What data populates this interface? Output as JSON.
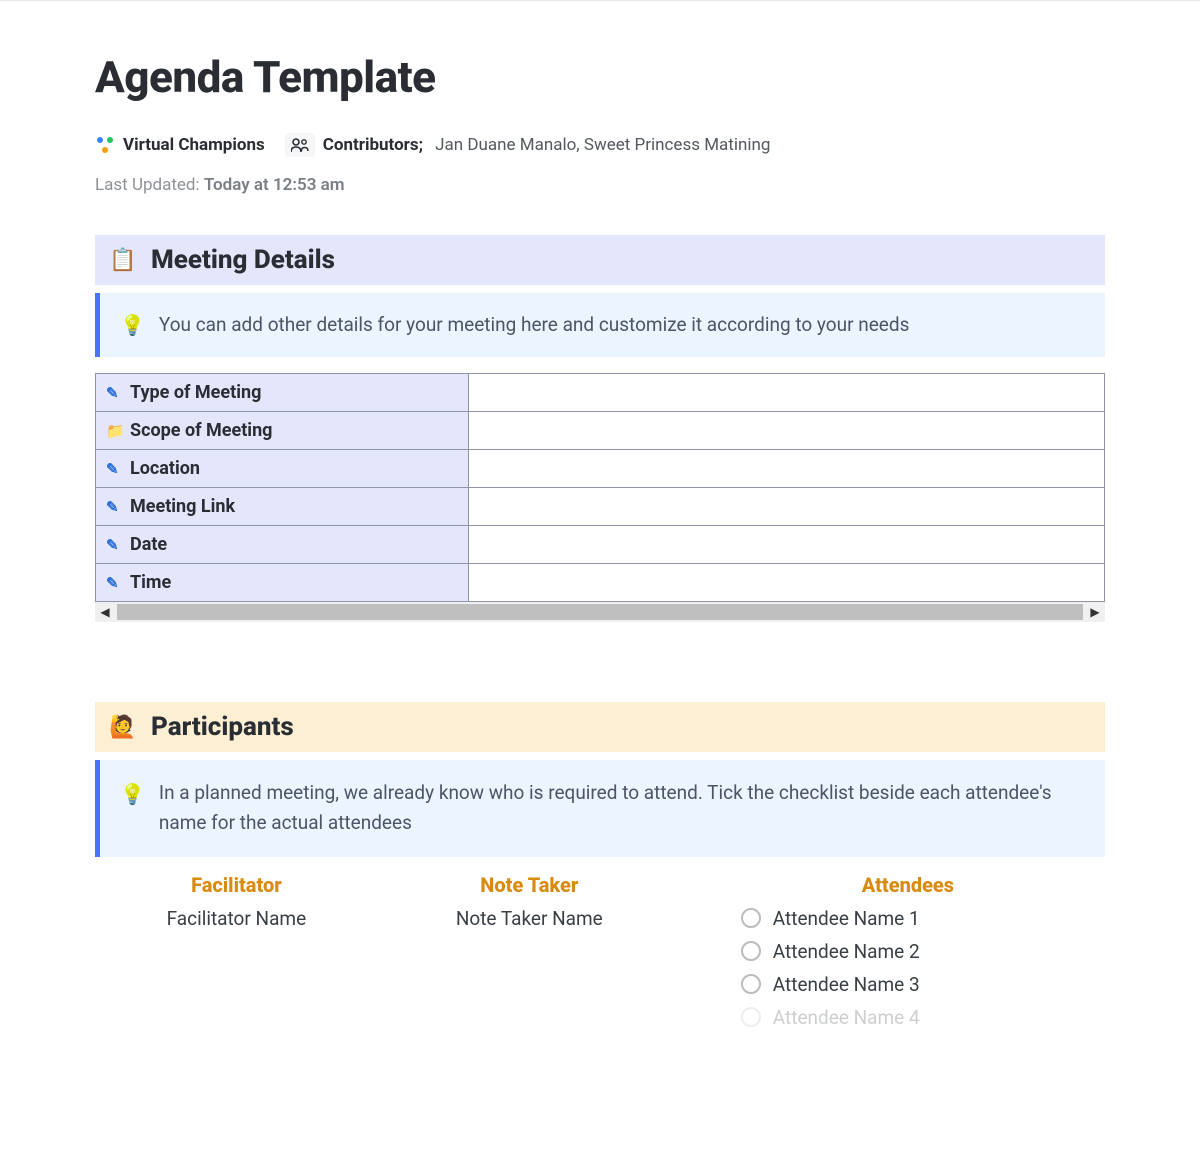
{
  "page_title": "Agenda Template",
  "organization": "Virtual Champions",
  "contributors": {
    "label": "Contributors;",
    "value": "Jan Duane Manalo, Sweet Princess Matining"
  },
  "last_updated": {
    "label": "Last Updated:",
    "value": "Today at 12:53 am"
  },
  "sections": {
    "meeting": {
      "icon": "📋",
      "title": "Meeting Details",
      "tip_icon": "💡",
      "tip": "You can add other details for your meeting here and customize it according to your needs",
      "rows": [
        {
          "icon": "pencil",
          "label": "Type of Meeting",
          "value": ""
        },
        {
          "icon": "folder",
          "label": "Scope of Meeting",
          "value": ""
        },
        {
          "icon": "pencil",
          "label": "Location",
          "value": ""
        },
        {
          "icon": "pencil",
          "label": "Meeting Link",
          "value": ""
        },
        {
          "icon": "pencil",
          "label": "Date",
          "value": ""
        },
        {
          "icon": "pencil",
          "label": "Time",
          "value": ""
        }
      ]
    },
    "participants": {
      "icon": "🙋",
      "title": "Participants",
      "tip_icon": "💡",
      "tip": "In a planned meeting, we already know who is required to attend. Tick the checklist beside each attendee's name for the actual attendees",
      "facilitator": {
        "heading": "Facilitator",
        "value": "Facilitator Name"
      },
      "note_taker": {
        "heading": "Note Taker",
        "value": "Note Taker Name"
      },
      "attendees": {
        "heading": "Attendees",
        "items": [
          "Attendee Name 1",
          "Attendee Name 2",
          "Attendee Name 3",
          "Attendee Name 4"
        ]
      }
    }
  },
  "scrollbar": {
    "left": "◀",
    "right": "▶"
  }
}
